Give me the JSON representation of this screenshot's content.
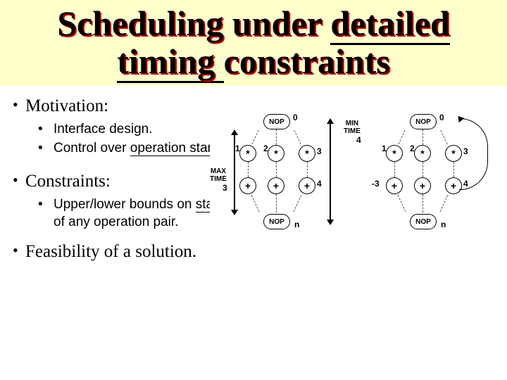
{
  "title": {
    "p1": "Scheduling under ",
    "p2": "detailed",
    "p3": "timing ",
    "p4": "constraints"
  },
  "sec1": {
    "label": "Motivation:"
  },
  "sub1a": "Interface design.",
  "sub1b": {
    "p1": "Control over ",
    "p2": "operation start time",
    "p3": "."
  },
  "sec2": {
    "label": "Constraints:"
  },
  "sub2a": {
    "p1": "Upper/lower bounds on ",
    "p2": "start-time difference",
    "p3": " of any operation pair."
  },
  "sec3": {
    "label": "Feasibility of a solution."
  },
  "diagram": {
    "nop": "NOP",
    "star": "*",
    "plus": "+",
    "maxtime": "MAX\nTIME",
    "mintime": "MIN\nTIME",
    "nums": {
      "n0": "0",
      "n1": "1",
      "n2": "2",
      "n3": "3",
      "n4": "4",
      "nm3": "-3",
      "nn": "n"
    }
  }
}
